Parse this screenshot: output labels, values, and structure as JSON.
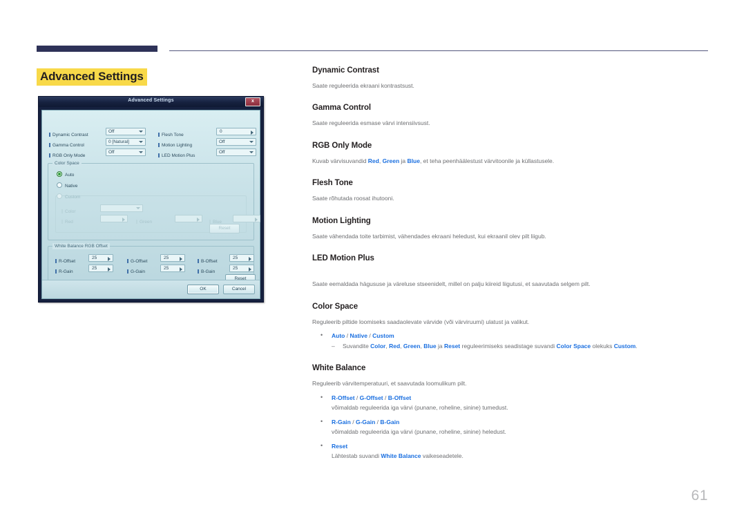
{
  "page_title": "Advanced Settings",
  "page_number": "61",
  "accent": {
    "link_blue": "#1a6fe0",
    "title_highlight": "#f8d949",
    "rule_navy": "#2e3258",
    "body_gray": "#6d6e71"
  },
  "osd": {
    "window_title": "Advanced Settings",
    "close_label": "x",
    "rows": [
      {
        "label": "Dynamic Contrast",
        "value": "Off"
      },
      {
        "label": "Gamma Control",
        "value": "0 [Natural]"
      },
      {
        "label": "RGB Only Mode",
        "value": "Off"
      },
      {
        "label": "Flesh Tone",
        "value": "0"
      },
      {
        "label": "Motion Lighting",
        "value": "Off"
      },
      {
        "label": "LED Motion Plus",
        "value": "Off"
      }
    ],
    "color_space": {
      "group_label": "Color Space",
      "options": [
        "Auto",
        "Native",
        "Custom"
      ],
      "selected": "Auto",
      "custom_group_label": "Custom",
      "color_label": "Color",
      "color_value": "",
      "red_label": "Red",
      "red_value": "",
      "green_label": "Green",
      "green_value": "",
      "blue_label": "Blue",
      "blue_value": "",
      "reset_label": "Reset"
    },
    "white_balance": {
      "group_label": "White Balance RGB Offset",
      "fields": [
        {
          "label": "R-Offset",
          "value": "25"
        },
        {
          "label": "G-Offset",
          "value": "25"
        },
        {
          "label": "B-Offset",
          "value": "25"
        },
        {
          "label": "R-Gain",
          "value": "25"
        },
        {
          "label": "G-Gain",
          "value": "25"
        },
        {
          "label": "B-Gain",
          "value": "25"
        }
      ],
      "reset_label": "Reset"
    },
    "ok_label": "OK",
    "cancel_label": "Cancel"
  },
  "sections": {
    "dynamic_contrast": {
      "heading": "Dynamic Contrast",
      "body": "Saate reguleerida ekraani kontrastsust."
    },
    "gamma_control": {
      "heading": "Gamma Control",
      "body": "Saate reguleerida esmase värvi intensiivsust."
    },
    "rgb_only_mode": {
      "heading": "RGB Only Mode",
      "body_pre": "Kuvab värvisuvandid ",
      "kw_red": "Red",
      "body_c1": ", ",
      "kw_green": "Green",
      "body_c2": " ja ",
      "kw_blue": "Blue",
      "body_post": ", et teha peenhäälestust värvitoonile ja küllastusele."
    },
    "flesh_tone": {
      "heading": "Flesh Tone",
      "body": "Saate rõhutada roosat ihutooni."
    },
    "motion_lighting": {
      "heading": "Motion Lighting",
      "body": "Saate vähendada toite tarbimist, vähendades ekraani heledust, kui ekraanil olev pilt liigub."
    },
    "led_motion_plus": {
      "heading": "LED Motion Plus",
      "body": "Saate eemaldada hägususe ja väreluse stseenidelt, millel on palju kiireid liigutusi, et saavutada selgem pilt."
    },
    "color_space": {
      "heading": "Color Space",
      "body": "Reguleerib piltide loomiseks saadaolevate värvide (või värviruumi) ulatust ja valikut.",
      "item_auto": "Auto",
      "sep1": " / ",
      "item_native": "Native",
      "sep2": " / ",
      "item_custom": "Custom",
      "sub_pre": "Suvandite ",
      "kw_color": "Color",
      "sub_c1": ", ",
      "kw_red": "Red",
      "sub_c2": ", ",
      "kw_green": "Green",
      "sub_c3": ", ",
      "kw_blue": "Blue",
      "sub_c4": " ja ",
      "kw_reset": "Reset",
      "sub_mid": " reguleerimiseks seadistage suvandi ",
      "kw_color_space": "Color Space",
      "sub_mid2": " olekuks ",
      "kw_custom": "Custom",
      "sub_end": "."
    },
    "white_balance": {
      "heading": "White Balance",
      "body": "Reguleerib värvitemperatuuri, et saavutada loomulikum pilt.",
      "item1_a": "R-Offset",
      "item1_s1": " / ",
      "item1_b": "G-Offset",
      "item1_s2": " / ",
      "item1_c": "B-Offset",
      "item1_sub": "võimaldab reguleerida iga värvi (punane, roheline, sinine) tumedust.",
      "item2_a": "R-Gain",
      "item2_s1": " / ",
      "item2_b": "G-Gain",
      "item2_s2": " / ",
      "item2_c": "B-Gain",
      "item2_sub": "võimaldab reguleerida iga värvi (punane, roheline, sinine) heledust.",
      "item3_a": "Reset",
      "item3_sub_pre": "Lähtestab suvandi ",
      "item3_kw": "White Balance",
      "item3_sub_post": " vaikeseadetele."
    }
  }
}
